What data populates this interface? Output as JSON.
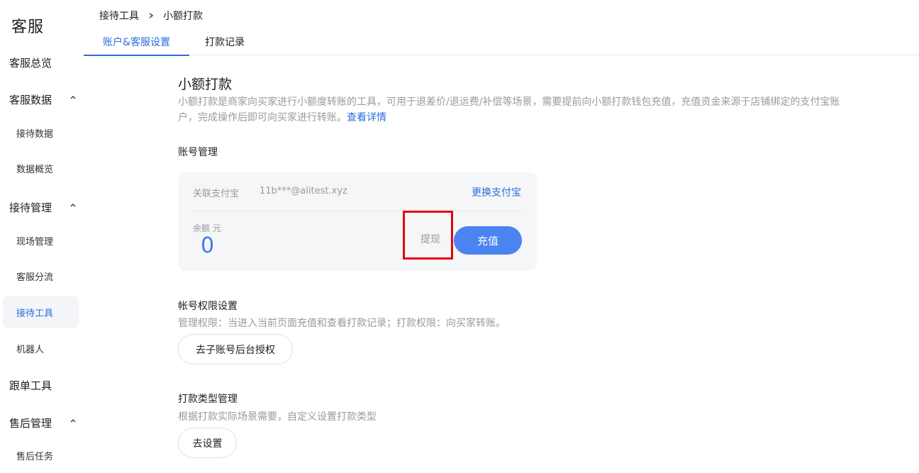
{
  "sidebar": {
    "title": "客服",
    "groups": {
      "overview": "客服总览",
      "data": "客服数据",
      "reception": "接待管理",
      "followup": "跟单工具",
      "aftersales": "售后管理"
    },
    "subs": {
      "reception_data": "接待数据",
      "data_summary": "数据概览",
      "site_mgmt": "现场管理",
      "cs_routing": "客服分流",
      "reception_tools": "接待工具",
      "robot": "机器人",
      "aftersales_tasks": "售后任务"
    }
  },
  "breadcrumb": {
    "parent": "接待工具",
    "current": "小额打款"
  },
  "tabs": {
    "settings": "账户&客服设置",
    "records": "打款记录"
  },
  "main": {
    "title": "小额打款",
    "description": "小额打款是商家向买家进行小额度转账的工具，可用于退差价/退运费/补偿等场景，需要提前向小额打款钱包充值，充值资金来源于店铺绑定的支付宝账户，完成操作后即可向买家进行转账。",
    "details_link": "查看详情",
    "account_section": "账号管理",
    "card": {
      "bind_label": "关联支付宝",
      "account": "11b***@alitest.xyz",
      "change_link": "更换支付宝",
      "balance_label": "余额 元",
      "balance_value": "0",
      "withdraw": "提现",
      "recharge": "充值"
    },
    "permission": {
      "title": "帐号权限设置",
      "desc": "管理权限：当进入当前页面充值和查看打款记录；打款权限：向买家转账。",
      "button": "去子账号后台授权"
    },
    "payment_type": {
      "title": "打款类型管理",
      "desc": "根据打款实际场景需要，自定义设置打款类型",
      "button": "去设置"
    }
  },
  "colors": {
    "accent": "#2d6be0",
    "button": "#4a84f0",
    "highlight": "#e60012"
  }
}
